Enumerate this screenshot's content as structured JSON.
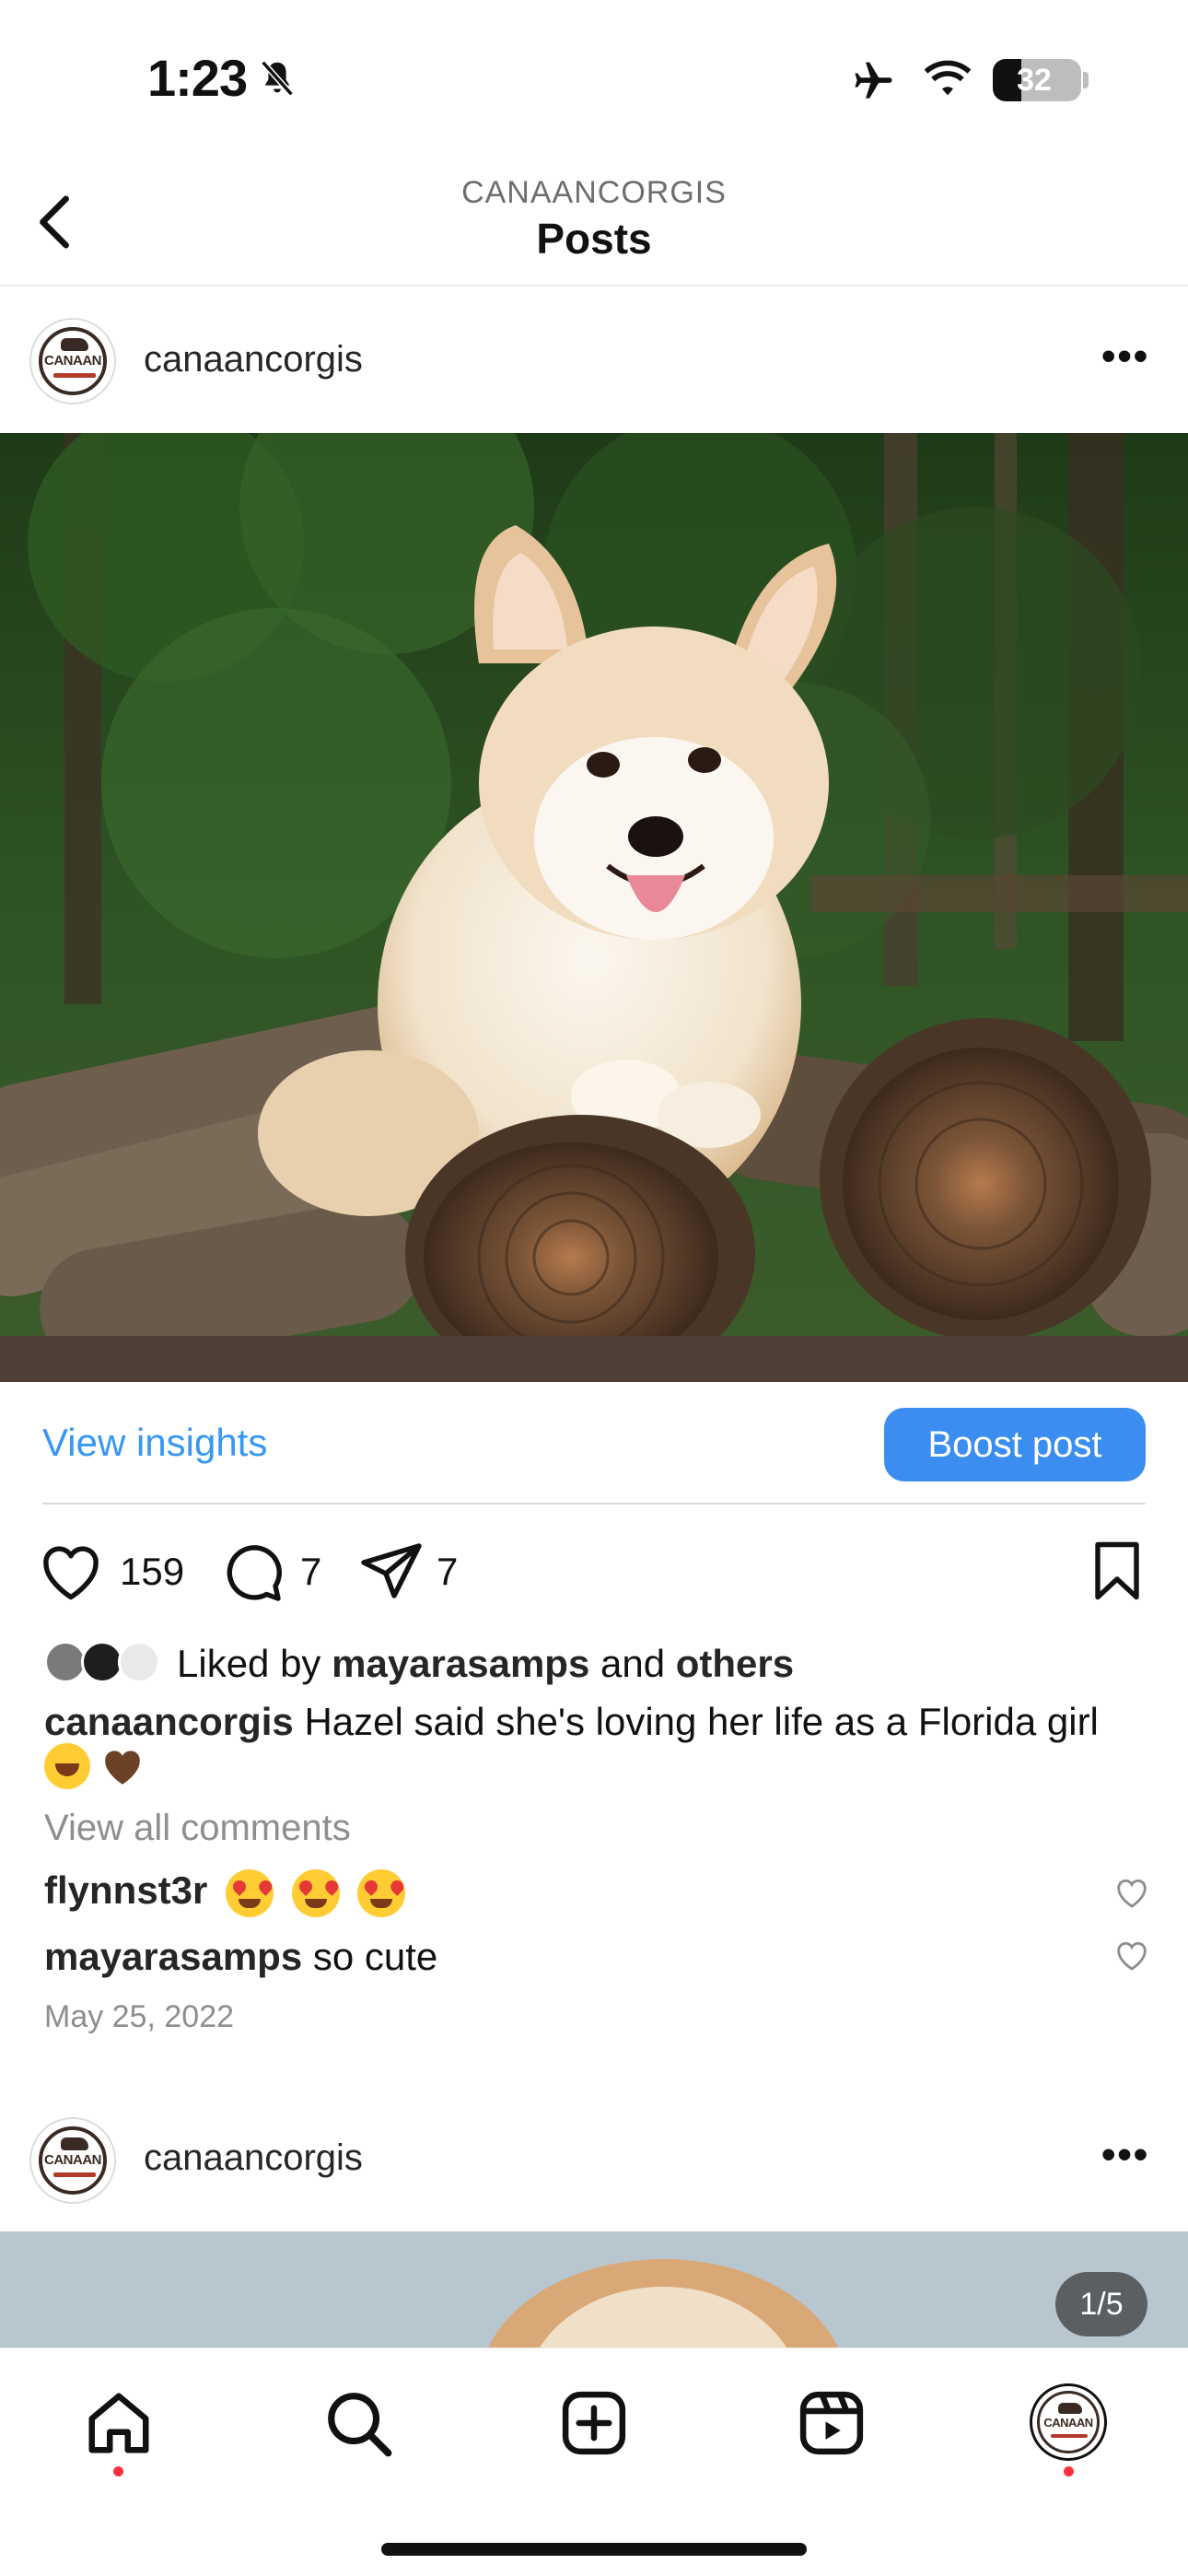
{
  "status_bar": {
    "time": "1:23",
    "battery": "32",
    "icons": [
      "bell-slash-icon",
      "airplane-icon",
      "wifi-icon",
      "battery-icon"
    ]
  },
  "header": {
    "account": "CANAANCORGIS",
    "title": "Posts"
  },
  "post": {
    "username": "canaancorgis",
    "avatar_label": "CANAAN",
    "view_insights": "View insights",
    "boost_post": "Boost post",
    "likes_count": "159",
    "comments_count": "7",
    "shares_count": "7",
    "liked_by_prefix": "Liked by",
    "liked_by_user": "mayarasamps",
    "liked_by_and": "and",
    "liked_by_others": "others",
    "caption_user": "canaancorgis",
    "caption_text": "Hazel said she's loving her life as a Florida girl",
    "view_all_comments": "View all comments",
    "comments": [
      {
        "user": "flynnst3r",
        "text": ""
      },
      {
        "user": "mayarasamps",
        "text": "so cute"
      }
    ],
    "date": "May 25, 2022"
  },
  "next_post": {
    "username": "canaancorgis",
    "carousel_indicator": "1/5"
  },
  "tab_bar": {
    "items": [
      "home-icon",
      "search-icon",
      "create-icon",
      "reels-icon",
      "profile-icon"
    ]
  }
}
